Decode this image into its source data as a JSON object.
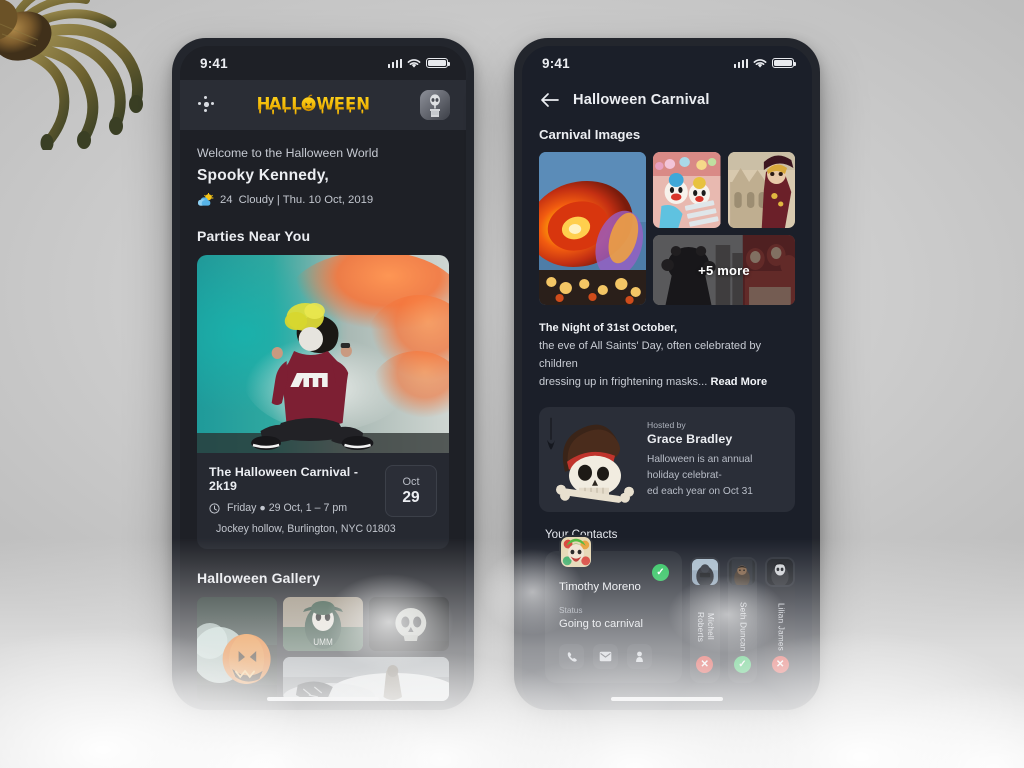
{
  "left_phone": {
    "statusbar": {
      "time": "9:41",
      "signal_icon": "cellular-bars-icon",
      "wifi_icon": "wifi-icon",
      "battery_icon": "battery-icon"
    },
    "header": {
      "menu_icon": "dots-menu-icon",
      "logo_text": "HALLOWEEN",
      "avatar_icon": "skeleton-avatar"
    },
    "welcome_text": "Welcome to the Halloween World",
    "user_name": "Spooky Kennedy,",
    "weather": {
      "icon": "sun-behind-cloud-icon",
      "temperature": "24",
      "summary": "Cloudy | Thu. 10 Oct, 2019"
    },
    "parties_section_title": "Parties Near You",
    "event_card": {
      "hero_image": "person-with-smoke-bomb-photo",
      "title": "The Halloween Carnival - 2k19",
      "time_icon": "clock-icon",
      "time_text": "Friday  ●  29 Oct, 1 – 7 pm",
      "location_icon": "map-pin-icon",
      "location_text": "Jockey hollow, Burlington, NYC 01803",
      "date_month": "Oct",
      "date_day": "29"
    },
    "gallery_section_title": "Halloween Gallery",
    "gallery": [
      {
        "name": "smoking-jack-o-lantern-photo"
      },
      {
        "name": "man-in-skull-makeup-photo"
      },
      {
        "name": "skull-on-dark-photo"
      },
      {
        "name": "foggy-figure-photo"
      }
    ]
  },
  "right_phone": {
    "statusbar": {
      "time": "9:41",
      "signal_icon": "cellular-bars-icon",
      "wifi_icon": "wifi-icon",
      "battery_icon": "battery-icon"
    },
    "nav": {
      "back_icon": "back-arrow-icon",
      "title": "Halloween Carnival"
    },
    "images_section_title": "Carnival Images",
    "carnival_images": [
      {
        "name": "spinning-carnival-ride-photo"
      },
      {
        "name": "carnival-clown-floats-photo"
      },
      {
        "name": "venice-masquerade-photo"
      },
      {
        "name": "carnival-crowd-photo",
        "overlay_label": "+5 more"
      }
    ],
    "description": {
      "headline": "The Night of 31st October,",
      "line1": "the eve of All Saints' Day, often celebrated by children",
      "line2": "dressing up in frightening masks...",
      "read_more": "Read More"
    },
    "host_card": {
      "image": "witch-hat-skull-and-crossbones",
      "label": "Hosted by",
      "name": "Grace Bradley",
      "description_line1": "Halloween is an annual holiday celebrat-",
      "description_line2": "ed each year on Oct 31"
    },
    "contacts_title": "Your Contacts",
    "contacts": [
      {
        "name": "Timothy Moreno",
        "avatar": "joker-clown-avatar",
        "status_label": "Status",
        "status_value": "Going to carnival",
        "attending": "accepted",
        "badge_icon": "check-circle-icon",
        "actions": [
          {
            "name": "call-button",
            "icon": "phone-icon"
          },
          {
            "name": "message-button",
            "icon": "mail-icon"
          },
          {
            "name": "profile-button",
            "icon": "person-icon"
          }
        ]
      },
      {
        "name": "Michell Roberts",
        "avatar": "contact-photo",
        "attending": "declined",
        "badge_icon": "x-circle-icon",
        "badge_symbol": "✕"
      },
      {
        "name": "Seth Duncan",
        "avatar": "contact-photo",
        "attending": "accepted",
        "badge_icon": "check-circle-icon",
        "badge_symbol": "✓"
      },
      {
        "name": "Lilian James",
        "avatar": "contact-photo",
        "attending": "declined",
        "badge_icon": "x-circle-icon",
        "badge_symbol": "✕"
      }
    ]
  },
  "colors": {
    "accent_yellow": "#f2c00a",
    "accept_green": "#2ec45f",
    "decline_red": "#e23b34",
    "phone_frame": "#23262d",
    "screen_bg_left": "#1e2026",
    "screen_bg_right": "#1b1f29",
    "card_bg": "#272b34"
  },
  "decorations": {
    "spider": "tarantula-decoration",
    "fog": "fog-decoration"
  }
}
